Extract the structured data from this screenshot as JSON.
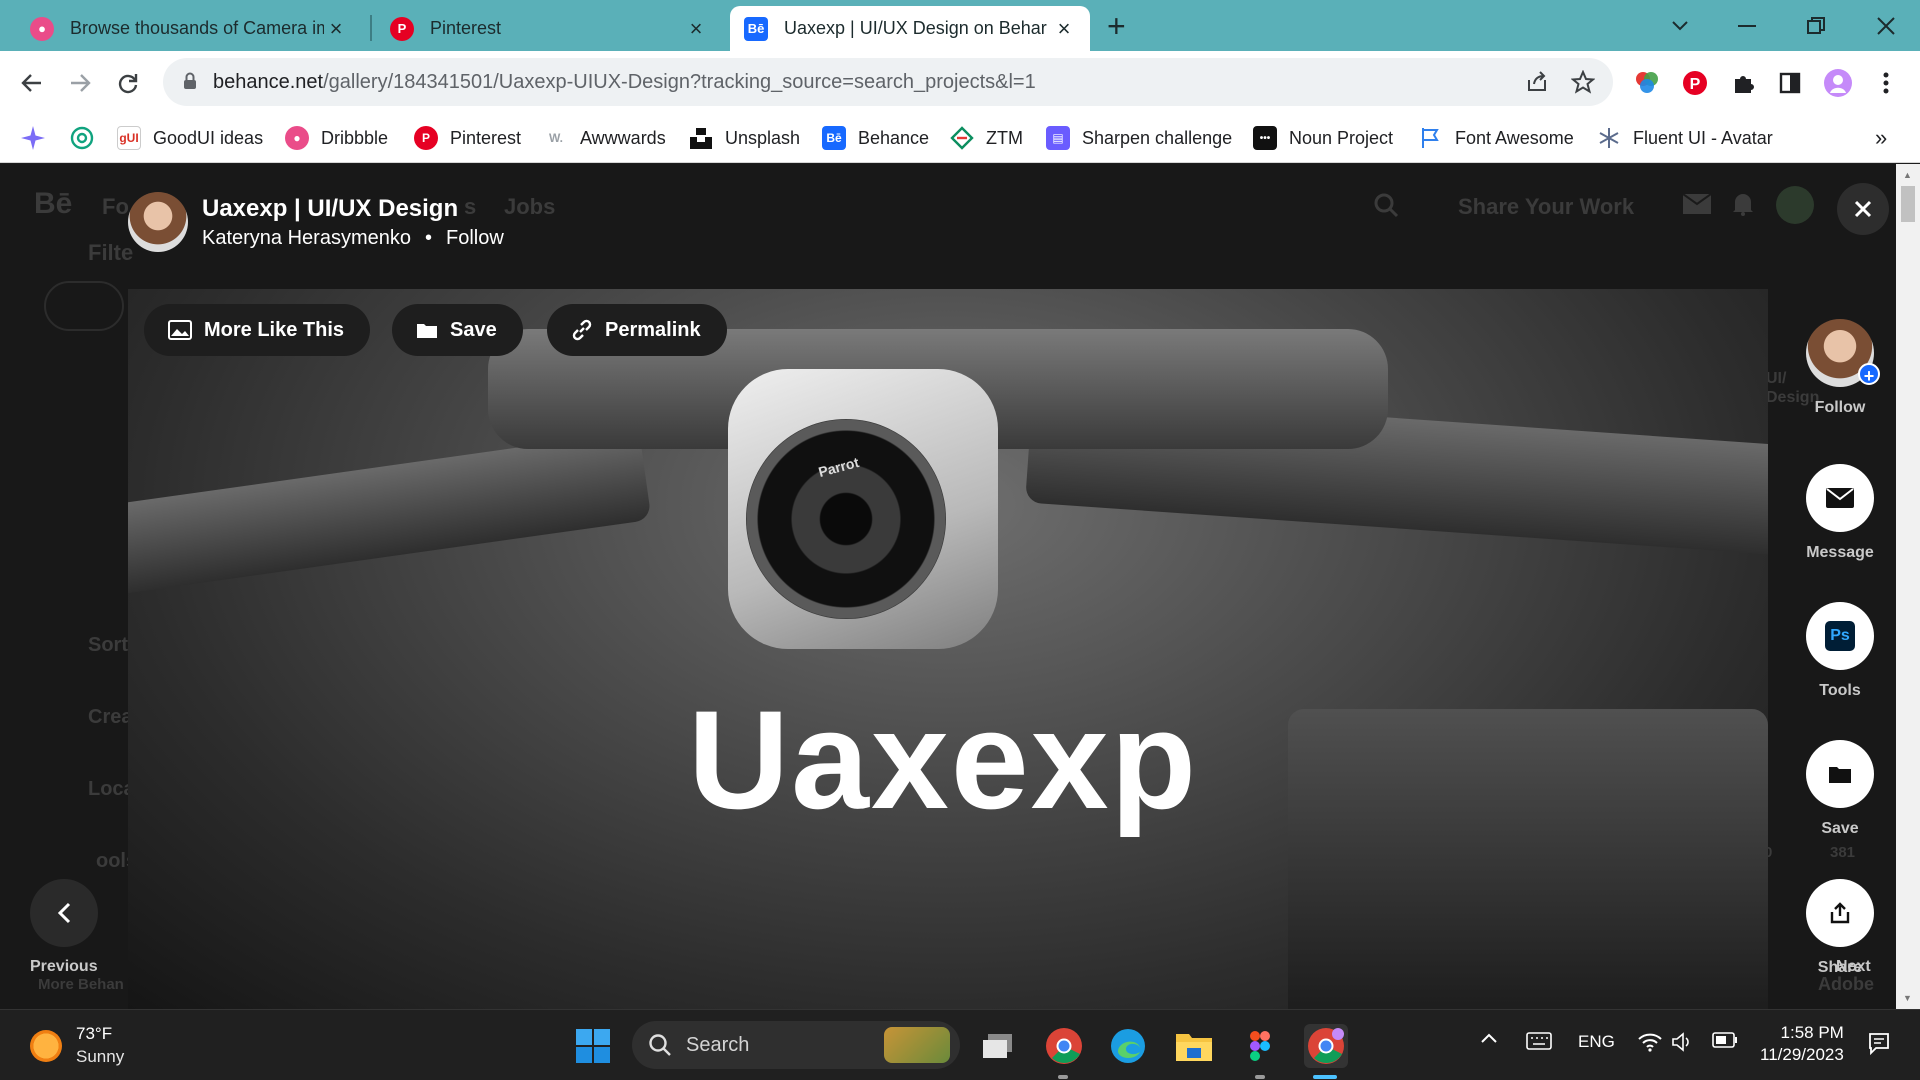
{
  "browser": {
    "tabs": [
      {
        "title": "Browse thousands of Camera im",
        "favicon": "dribbble-icon",
        "active": false
      },
      {
        "title": "Pinterest",
        "favicon": "pinterest-icon",
        "active": false
      },
      {
        "title": "Uaxexp | UI/UX Design on Behar",
        "favicon": "behance-icon",
        "active": true
      }
    ],
    "favicon_text": {
      "behance": "Bē"
    },
    "url": {
      "host": "behance.net",
      "path": "/gallery/184341501/Uaxexp-UIUX-Design?tracking_source=search_projects&l=1"
    },
    "bookmarks": [
      {
        "label": "GoodUI ideas",
        "icon": "goodui-icon"
      },
      {
        "label": "Dribbble",
        "icon": "dribbble-icon"
      },
      {
        "label": "Pinterest",
        "icon": "pinterest-icon"
      },
      {
        "label": "Awwwards",
        "icon": "awwwards-icon"
      },
      {
        "label": "Unsplash",
        "icon": "unsplash-icon"
      },
      {
        "label": "Behance",
        "icon": "behance-icon"
      },
      {
        "label": "ZTM",
        "icon": "ztm-icon"
      },
      {
        "label": "Sharpen challenge",
        "icon": "sharpen-icon"
      },
      {
        "label": "Noun Project",
        "icon": "noun-project-icon"
      },
      {
        "label": "Font Awesome",
        "icon": "font-awesome-icon"
      },
      {
        "label": "Fluent UI - Avatar",
        "icon": "fluent-icon"
      }
    ],
    "bookmark_icon_text": {
      "goodui": "gUI",
      "awwwards": "W.",
      "noun": "•••"
    },
    "more_bookmarks": "»"
  },
  "background_page": {
    "logo": "Bē",
    "nav_fragment_1": "Fo",
    "nav_fragment_2": "s",
    "jobs": "Jobs",
    "share_work": "Share Your Work",
    "filter_fragment": "Filte",
    "sort_fragment": "Sort",
    "creative_fragment": "Crea",
    "location_fragment": "Loca",
    "tools_fragment": "ools",
    "more_behance": "More Behan",
    "ui_design_1": "UI/",
    "ui_design_2": "Design",
    "views_count": "381",
    "views_zero": "0",
    "adobe": "Adobe"
  },
  "project": {
    "title": "Uaxexp | UI/UX Design",
    "author": "Kateryna Herasymenko",
    "separator": "•",
    "follow_label": "Follow",
    "hero_text": "Uaxexp",
    "camera_text": "Parrot",
    "actions": {
      "more_like_this": "More Like This",
      "save": "Save",
      "permalink": "Permalink"
    }
  },
  "rail": {
    "follow": "Follow",
    "message": "Message",
    "tools": "Tools",
    "tools_badge": "Ps",
    "save": "Save",
    "share": "Share",
    "next": "Next",
    "previous": "Previous"
  },
  "taskbar": {
    "weather_temp": "73°F",
    "weather_desc": "Sunny",
    "search_label": "Search",
    "language": "ENG",
    "time": "1:58 PM",
    "date": "11/29/2023"
  },
  "colors": {
    "tabstrip": "#5ab0b8",
    "behance_blue": "#1769ff",
    "pinterest_red": "#e60023",
    "dribbble_pink": "#ea4c89"
  }
}
